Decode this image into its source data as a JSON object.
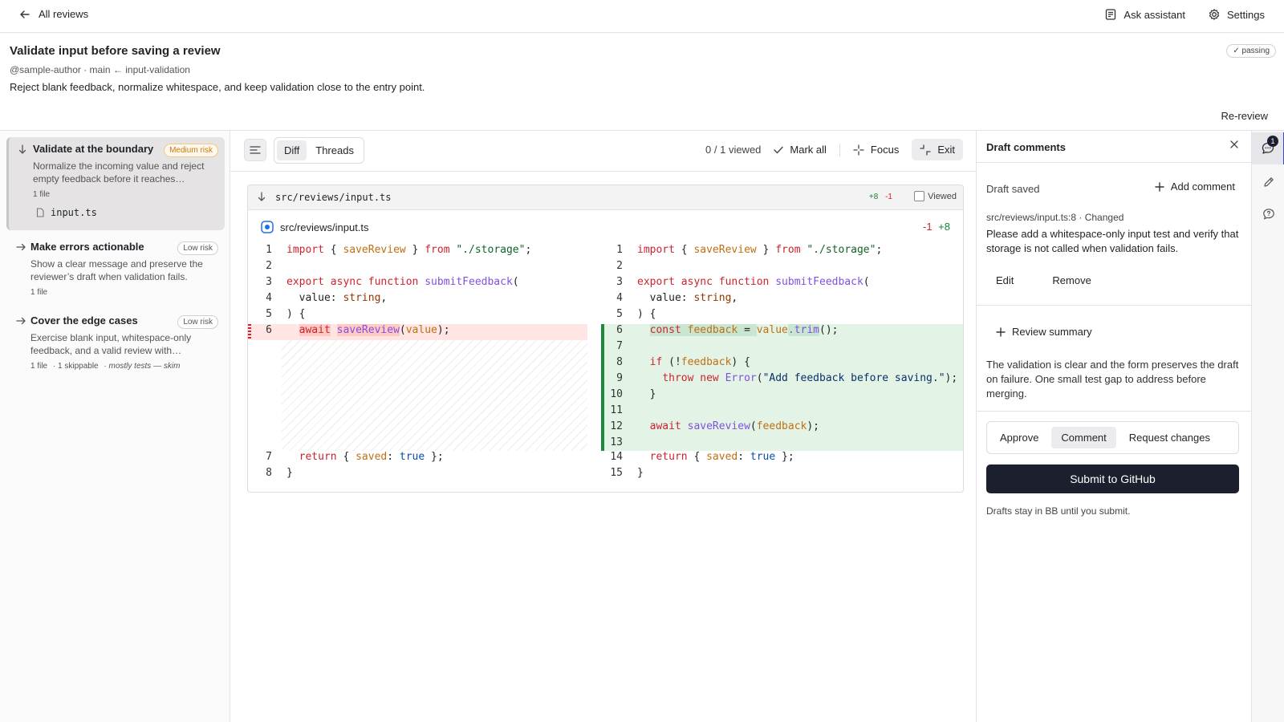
{
  "topbar": {
    "back_label": "All reviews",
    "ask_assistant": "Ask assistant",
    "settings": "Settings"
  },
  "header": {
    "title": "Validate input before saving a review",
    "meta": "@sample-author · main ← input-validation",
    "description": "Reject blank feedback, normalize whitespace, and keep validation close to the entry point.",
    "status_badge": "✓ passing",
    "rereview": "Re-review"
  },
  "sections": [
    {
      "title": "Validate at the boundary",
      "risk": "Medium risk",
      "description": "Normalize the incoming value and reject empty feedback before it reaches…",
      "meta": "1 file",
      "file": "input.ts"
    },
    {
      "title": "Make errors actionable",
      "risk": "Low risk",
      "description": "Show a clear message and preserve the reviewer’s draft when validation fails.",
      "meta": "1 file"
    },
    {
      "title": "Cover the edge cases",
      "risk": "Low risk",
      "description": "Exercise blank input, whitespace-only feedback, and a valid review with…",
      "meta": "1 file",
      "meta_extra": "· 1 skippable",
      "meta_note": "· mostly tests — skim"
    }
  ],
  "toolbar": {
    "tab_diff": "Diff",
    "tab_threads": "Threads",
    "viewed_count": "0 / 1 viewed",
    "mark_all": "Mark all",
    "focus": "Focus",
    "exit": "Exit"
  },
  "file": {
    "path": "src/reviews/input.ts",
    "additions": "+8",
    "deletions": "-1",
    "viewed_label": "Viewed",
    "sub_path": "src/reviews/input.ts",
    "sub_deletions": "-1",
    "sub_additions": "+8"
  },
  "diff": {
    "left_line_numbers": [
      "1",
      "2",
      "3",
      "4",
      "5",
      "6",
      "7",
      "8"
    ],
    "right_line_numbers": [
      "1",
      "2",
      "3",
      "4",
      "5",
      "6",
      "7",
      "8",
      "9",
      "10",
      "11",
      "12",
      "13",
      "14",
      "15"
    ]
  },
  "drafts": {
    "title": "Draft comments",
    "draft_saved": "Draft saved",
    "add_comment": "Add comment",
    "comment_location": "src/reviews/input.ts:8 · Changed",
    "comment_body": "Please add a whitespace-only input test and verify that storage is not called when validation fails.",
    "edit": "Edit",
    "remove": "Remove",
    "review_summary": "Review summary",
    "summary_text": "The validation is clear and the form preserves the draft on failure. One small test gap to address before merging.",
    "verdict_approve": "Approve",
    "verdict_comment": "Comment",
    "verdict_request": "Request changes",
    "submit": "Submit to GitHub",
    "submit_note": "Drafts stay in BB until you submit."
  },
  "rail": {
    "badge_count": "1"
  },
  "colors": {
    "deleted_bg": "#ffe5e3",
    "added_bg": "#e3f4e6",
    "added_bar": "#1f883d",
    "deleted_bar": "#cf222e",
    "submit_bg": "#1c1f2e"
  }
}
